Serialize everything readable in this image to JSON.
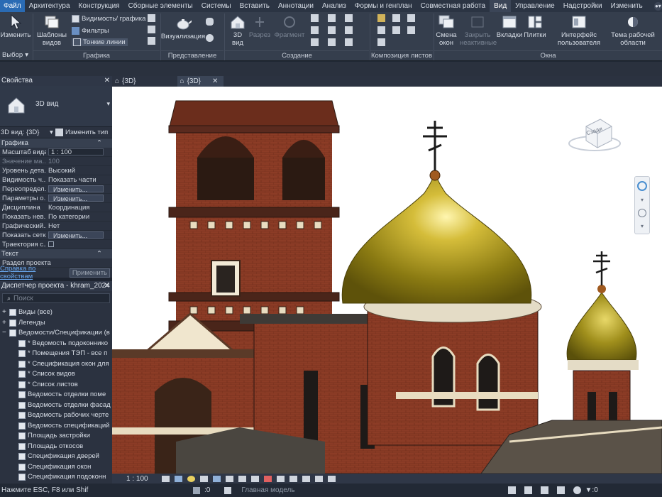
{
  "menu": [
    "Файл",
    "Архитектура",
    "Конструкция",
    "Сборные элементы",
    "Системы",
    "Вставить",
    "Аннотации",
    "Анализ",
    "Формы и генплан",
    "Совместная работа",
    "Вид",
    "Управление",
    "Надстройки",
    "Изменить"
  ],
  "ribbon": {
    "modify_label": "Изменить",
    "select_label": "Выбор",
    "templates_label": "Шаблоны видов",
    "visibility_label": "Видимость/ графика",
    "filters_label": "Фильтры",
    "thin_lines_label": "Тонкие линии",
    "group_graphics": "Графика",
    "render_label": "Визуализация",
    "group_presentation": "Представление",
    "view3d_label": "3D вид",
    "section_label": "Разрез",
    "callout_label": "Фрагмент",
    "group_create": "Создание",
    "group_sheets": "Композиция листов",
    "switch_windows_label": "Смена окон",
    "close_inactive_label": "Закрыть неактивные",
    "tabs_label": "Вкладки",
    "tiles_label": "Плитки",
    "ui_label": "Интерфейс пользователя",
    "theme_label": "Тема рабочей области",
    "group_windows": "Окна"
  },
  "properties": {
    "title": "Свойства",
    "type_name": "3D вид",
    "instance_label": "3D вид: {3D}",
    "edit_type": "Изменить тип",
    "section_graphics": "Графика",
    "rows": [
      {
        "k": "Масштаб вида",
        "v": "1 : 100",
        "style": "input"
      },
      {
        "k": "Значение ма...",
        "v": "100",
        "style": "dim"
      },
      {
        "k": "Уровень дета...",
        "v": "Высокий",
        "style": "plain"
      },
      {
        "k": "Видимость ч...",
        "v": "Показать части",
        "style": "plain"
      },
      {
        "k": "Переопредел...",
        "v": "Изменить...",
        "style": "btn"
      },
      {
        "k": "Параметры о...",
        "v": "Изменить...",
        "style": "btn"
      },
      {
        "k": "Дисциплина",
        "v": "Координация",
        "style": "plain"
      },
      {
        "k": "Показать нев...",
        "v": "По категории",
        "style": "plain"
      },
      {
        "k": "Графический...",
        "v": "Нет",
        "style": "plain"
      },
      {
        "k": "Показать сетки",
        "v": "Изменить...",
        "style": "btn"
      },
      {
        "k": "Траектория с...",
        "v": "",
        "style": "check"
      }
    ],
    "section_text": "Текст",
    "section_row": "Раздел проекта",
    "help_link": "Справка по свойствам",
    "apply_label": "Применить"
  },
  "browser": {
    "title": "Диспетчер проекта - khram_2024",
    "search_placeholder": "Поиск",
    "items": [
      {
        "label": "Виды (все)",
        "level": 0,
        "exp": "+"
      },
      {
        "label": "Легенды",
        "level": 0,
        "exp": "+"
      },
      {
        "label": "Ведомости/Спецификации (в",
        "level": 0,
        "exp": "−"
      },
      {
        "label": "* Ведомость подоконнико",
        "level": 1
      },
      {
        "label": "* Помещения ТЭП - все п",
        "level": 1
      },
      {
        "label": "* Спецификация окон для",
        "level": 1
      },
      {
        "label": "* Список видов",
        "level": 1
      },
      {
        "label": "* Список листов",
        "level": 1
      },
      {
        "label": "Ведомость отделки поме",
        "level": 1
      },
      {
        "label": "Ведомость отделки фасад",
        "level": 1
      },
      {
        "label": "Ведомость рабочих черте",
        "level": 1
      },
      {
        "label": "Ведомость спецификаций",
        "level": 1
      },
      {
        "label": "Площадь застройки",
        "level": 1
      },
      {
        "label": "Площадь откосов",
        "level": 1
      },
      {
        "label": "Спецификация дверей",
        "level": 1
      },
      {
        "label": "Спецификация окон",
        "level": 1
      },
      {
        "label": "Спецификация подоконн",
        "level": 1
      }
    ]
  },
  "view_tabs": [
    "{3D}",
    "{3D}"
  ],
  "viewcube_label": "Сзади",
  "view_scale": "1 : 100",
  "status": {
    "hint": "Нажмите ESC, F8 или Shif",
    "counter": ":0",
    "model": "Главная модель",
    "counter2": ":0"
  },
  "colors": {
    "accent": "#2a6bb4",
    "brick": "#8b3a26",
    "gold": "#b8a028"
  }
}
